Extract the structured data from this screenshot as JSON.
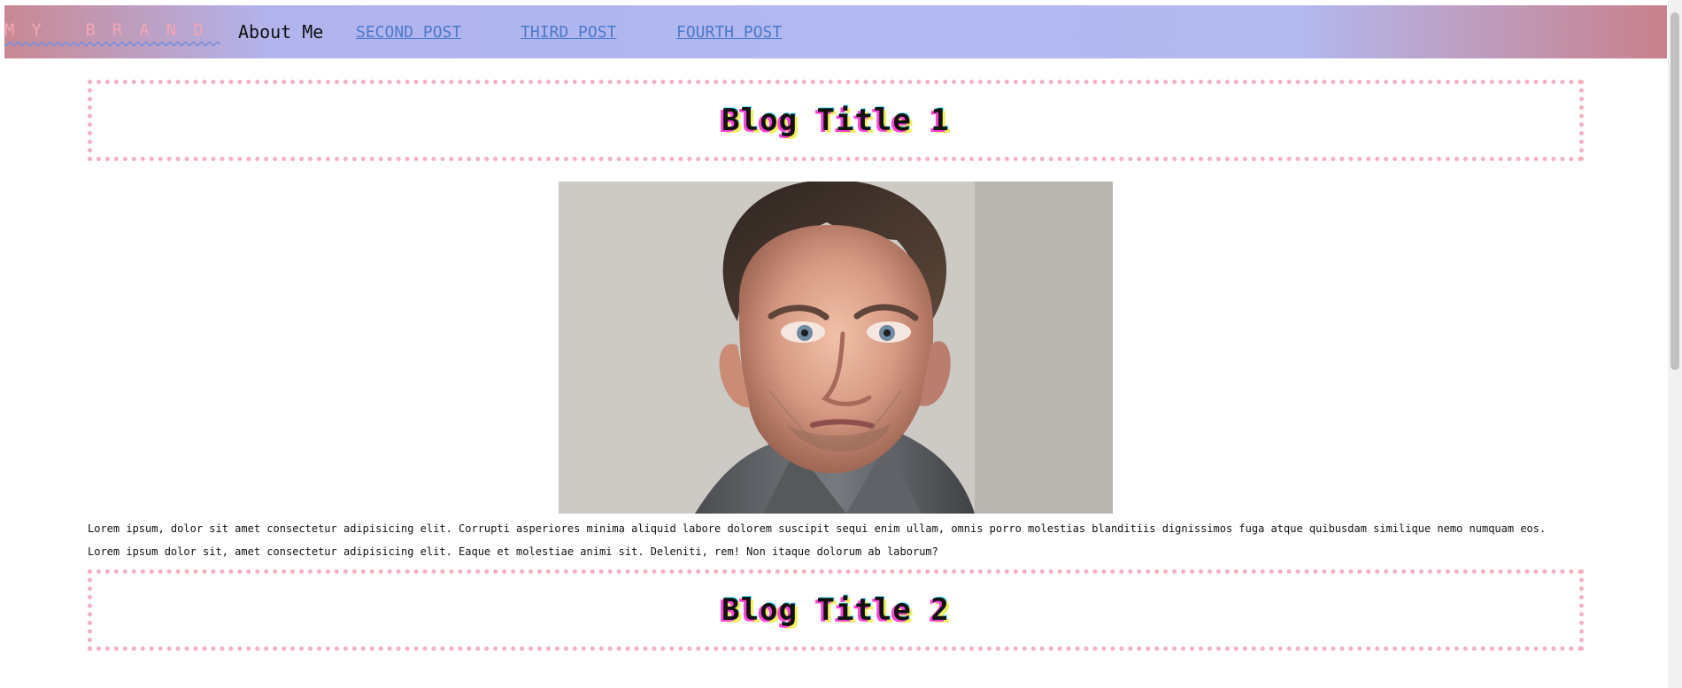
{
  "header": {
    "brand": "MY BRAND",
    "about_label": "About Me",
    "links": [
      "SECOND POST",
      "THIRD POST",
      "FOURTH POST"
    ]
  },
  "posts": [
    {
      "title": "Blog Title 1",
      "image_label": "portrait photo",
      "paragraphs": [
        "Lorem ipsum, dolor sit amet consectetur adipisicing elit. Corrupti asperiores minima aliquid labore dolorem suscipit sequi enim ullam, omnis porro molestias blanditiis dignissimos fuga atque quibusdam similique nemo numquam eos.",
        "Lorem ipsum dolor sit, amet consectetur adipisicing elit. Eaque et molestiae animi sit. Deleniti, rem! Non itaque dolorum ab laborum?"
      ]
    },
    {
      "title": "Blog Title 2"
    }
  ]
}
